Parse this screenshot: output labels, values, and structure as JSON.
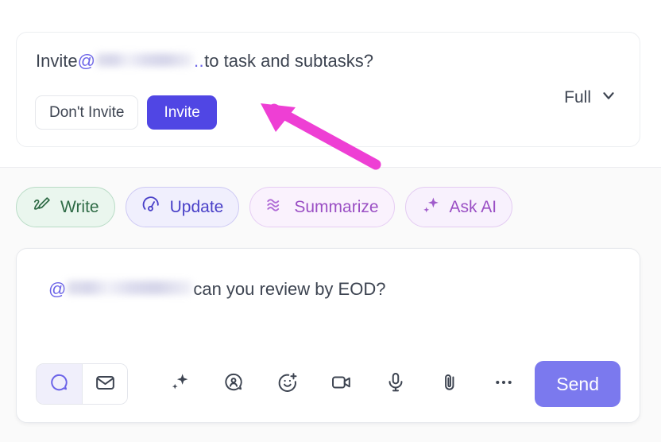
{
  "invite_card": {
    "headline_prefix": "Invite ",
    "at_sign": "@",
    "mention_redacted": "",
    "mention_tail": "..",
    "headline_suffix": " to task and subtasks?",
    "dont_invite_label": "Don't Invite",
    "invite_label": "Invite",
    "scope_value": "Full",
    "scope_icon": "chevron-down-icon"
  },
  "pills": [
    {
      "label": "Write",
      "icon": "pen-write-icon",
      "accent": "#2f6b46"
    },
    {
      "label": "Update",
      "icon": "gauge-icon",
      "accent": "#4940c8"
    },
    {
      "label": "Summarize",
      "icon": "waves-icon",
      "accent": "#9a4fc4"
    },
    {
      "label": "Ask AI",
      "icon": "sparkles-icon",
      "accent": "#9a4fc4"
    }
  ],
  "composer": {
    "at_sign": "@",
    "mention_redacted": "",
    "message_text": " can you review by EOD?",
    "mode_toggle": [
      {
        "name": "comment-mode",
        "icon": "chat-bubble-icon",
        "active": true
      },
      {
        "name": "email-mode",
        "icon": "envelope-icon",
        "active": false
      }
    ],
    "tools": [
      {
        "name": "ai-sparkle",
        "icon": "sparkles-icon"
      },
      {
        "name": "mention",
        "icon": "mention-person-icon"
      },
      {
        "name": "emoji",
        "icon": "add-emoji-icon"
      },
      {
        "name": "video",
        "icon": "video-camera-icon"
      },
      {
        "name": "audio",
        "icon": "microphone-icon"
      },
      {
        "name": "attachment",
        "icon": "paperclip-icon"
      },
      {
        "name": "more",
        "icon": "ellipsis-icon"
      }
    ],
    "send_label": "Send"
  },
  "annotation": {
    "type": "arrow",
    "color": "#ee3fd4",
    "points_to": "invite-button"
  },
  "colors": {
    "invite_button": "#5046e4",
    "send_button": "#7b79ee",
    "mention_purple": "#6b63e8",
    "arrow_magenta": "#ee3fd4",
    "page_background": "#fafafa"
  }
}
